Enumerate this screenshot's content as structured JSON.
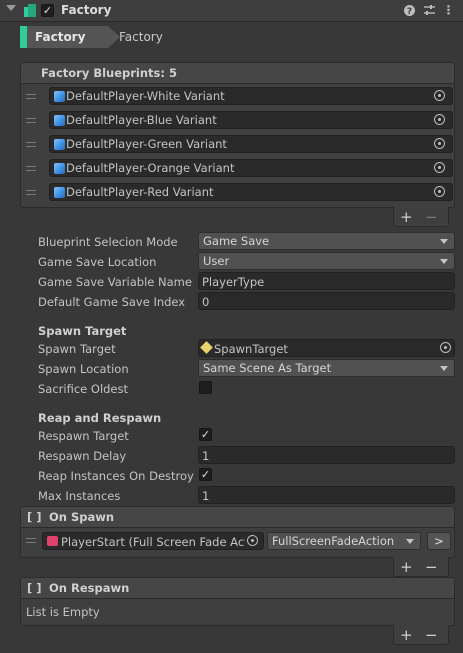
{
  "header": {
    "title": "Factory",
    "enabled": true
  },
  "breadcrumb": {
    "active": "Factory",
    "next": "Factory"
  },
  "blueprints": {
    "title": "Factory Blueprints: 5",
    "items": [
      "DefaultPlayer-White Variant",
      "DefaultPlayer-Blue Variant",
      "DefaultPlayer-Green Variant",
      "DefaultPlayer-Orange Variant",
      "DefaultPlayer-Red Variant"
    ]
  },
  "fields": {
    "blueprint_mode": {
      "label": "Blueprint Selecion Mode",
      "value": "Game Save"
    },
    "game_save_location": {
      "label": "Game Save Location",
      "value": "User"
    },
    "game_save_variable": {
      "label": "Game Save Variable Name",
      "value": "PlayerType"
    },
    "default_index": {
      "label": "Default Game Save Index",
      "value": "0"
    }
  },
  "spawn": {
    "section": "Spawn Target",
    "target": {
      "label": "Spawn Target",
      "value": "SpawnTarget"
    },
    "location": {
      "label": "Spawn Location",
      "value": "Same Scene As Target"
    },
    "sacrifice": {
      "label": "Sacrifice Oldest",
      "checked": false
    }
  },
  "reap": {
    "section": "Reap and Respawn",
    "respawn_target": {
      "label": "Respawn Target",
      "checked": true
    },
    "respawn_delay": {
      "label": "Respawn Delay",
      "value": "1"
    },
    "reap_on_destroy": {
      "label": "Reap Instances On Destroy",
      "checked": true
    },
    "max_instances": {
      "label": "Max Instances",
      "value": "1"
    }
  },
  "on_spawn": {
    "title": "On Spawn",
    "object": "PlayerStart (Full Screen Fade Act",
    "method": "FullScreenFadeAction",
    "go": ">"
  },
  "on_respawn": {
    "title": "On Respawn",
    "empty": "List is Empty"
  },
  "colors": {
    "accent": "#2fcd9c",
    "background": "#383838"
  }
}
